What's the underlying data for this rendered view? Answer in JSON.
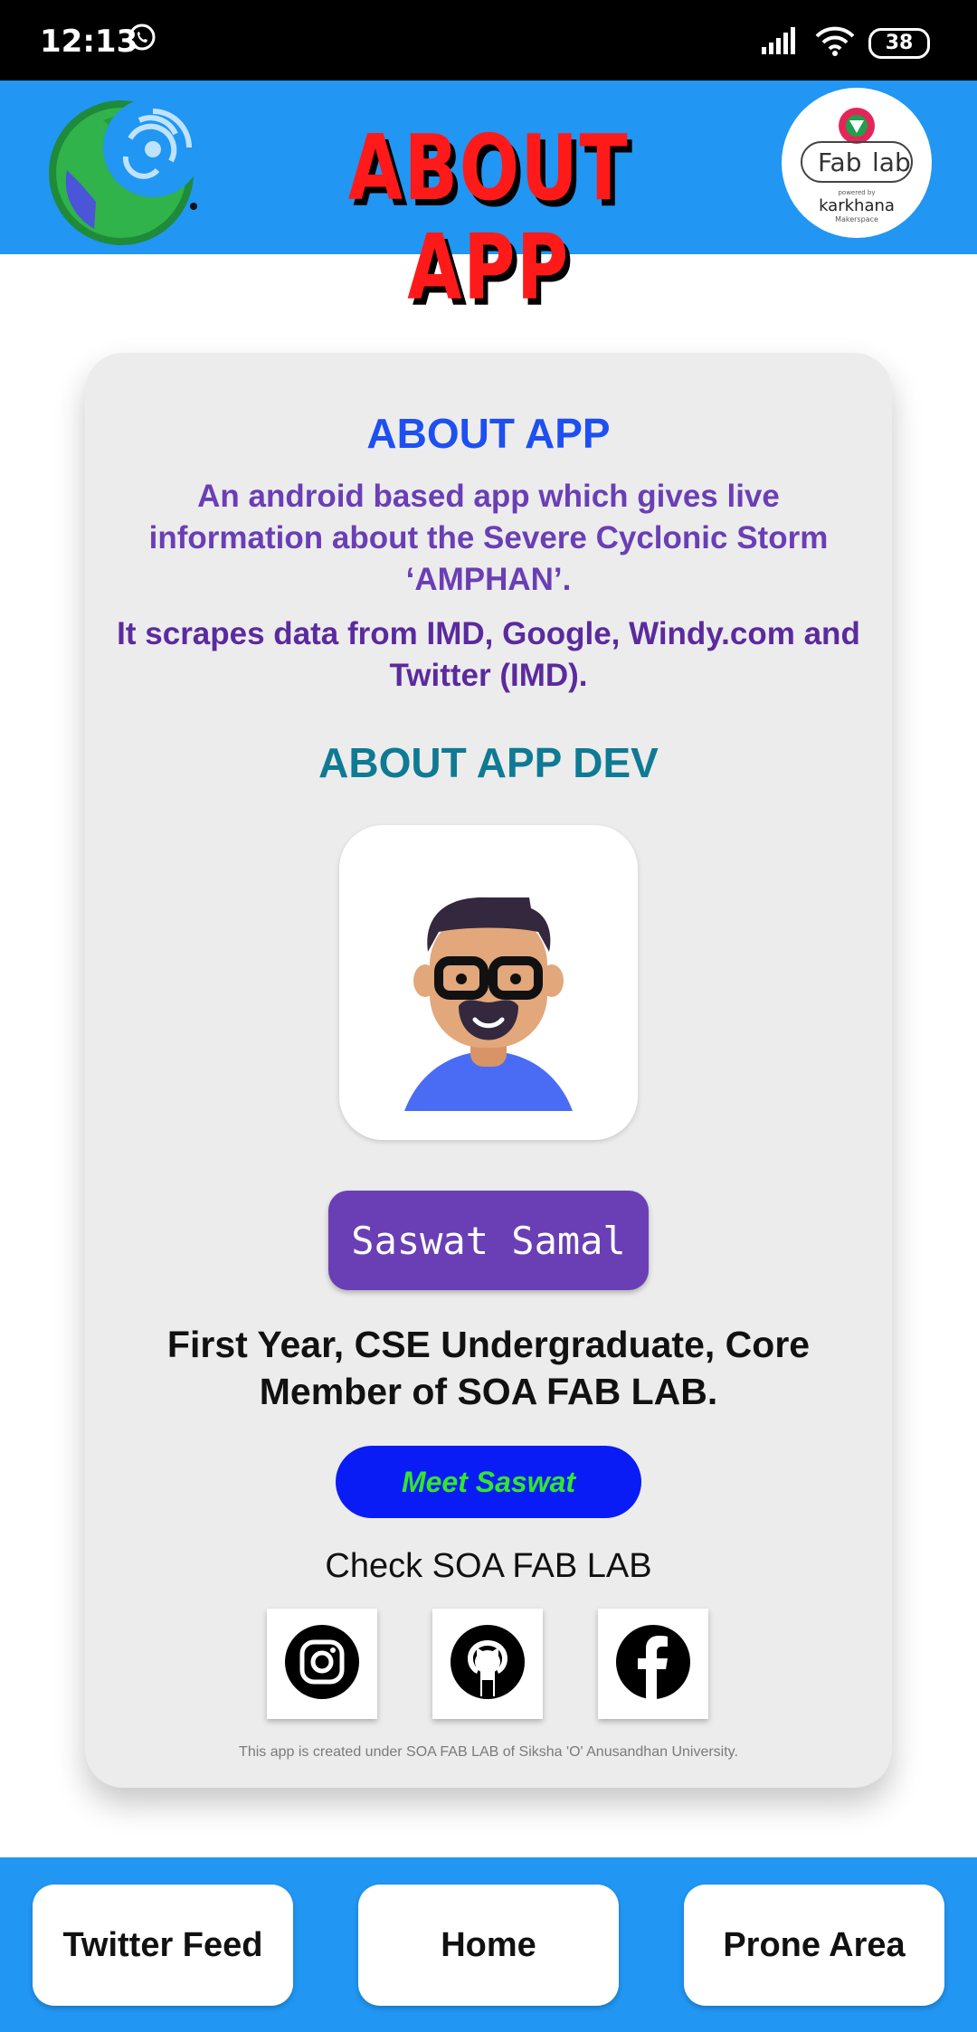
{
  "status_bar": {
    "time": "12:13",
    "battery": "38",
    "icons": [
      "whatsapp-icon",
      "signal-icon",
      "wifi-icon",
      "battery-icon"
    ]
  },
  "header": {
    "title": "ABOUT APP",
    "logo_left": "earth-cyclone-icon",
    "logo_right": {
      "line1": "Fab",
      "line2": "lab",
      "powered": "powered by",
      "brand": "karkhana",
      "sub": "Makerspace"
    },
    "background": "#2196f3"
  },
  "card": {
    "about_title": "ABOUT APP",
    "about_description": "An android based app which gives live information about the Severe Cyclonic Storm ‘AMPHAN’.",
    "about_sources": "It scrapes data from IMD, Google, Windy.com and Twitter (IMD).",
    "dev_title": "ABOUT APP DEV",
    "avatar_icon": "developer-avatar-icon",
    "dev_name": "Saswat Samal",
    "dev_role": "First Year, CSE Undergraduate, Core Member of SOA FAB LAB.",
    "meet_button": "Meet Saswat",
    "check_label": "Check SOA FAB LAB",
    "social_icons": [
      "instagram-icon",
      "github-icon",
      "facebook-icon"
    ],
    "credit": "This app is created under SOA FAB LAB of Siksha 'O' Anusandhan University."
  },
  "bottom_nav": {
    "left": "Twitter Feed",
    "center": "Home",
    "right": "Prone Area"
  },
  "colors": {
    "header_blue": "#2196f3",
    "title_red": "#ff1a1a",
    "about_blue": "#1e4ff0",
    "desc_purple": "#6a3fb5",
    "dev_teal": "#0f7a93",
    "name_button": "#6a3fb5",
    "meet_button": "#0a1cf5",
    "meet_text": "#33e62e"
  }
}
